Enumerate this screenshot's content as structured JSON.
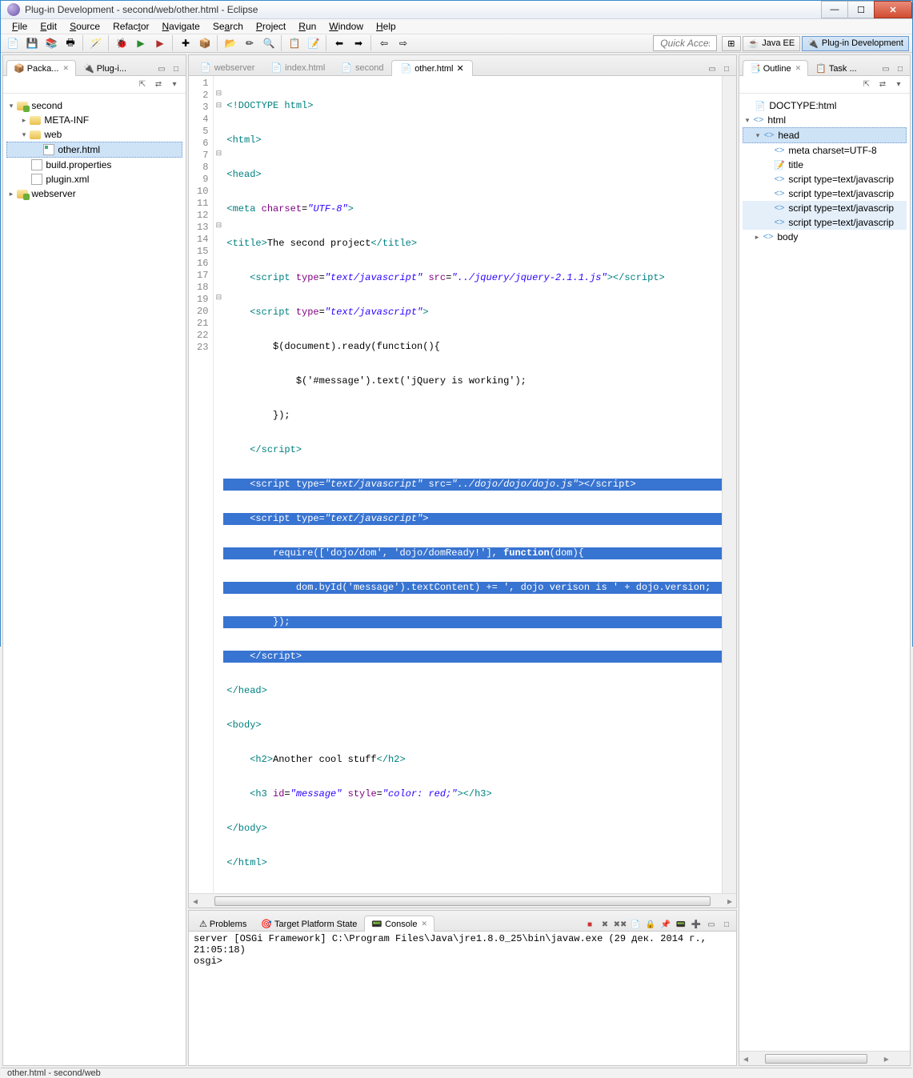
{
  "window": {
    "title": "Plug-in Development - second/web/other.html - Eclipse"
  },
  "menu": [
    "File",
    "Edit",
    "Source",
    "Refactor",
    "Navigate",
    "Search",
    "Project",
    "Run",
    "Window",
    "Help"
  ],
  "toolbar": {
    "quick_access": "Quick Access"
  },
  "perspectives": {
    "java_ee": "Java EE",
    "plugin_dev": "Plug-in Development"
  },
  "left_tabs": {
    "package": "Packa...",
    "plugins": "Plug-i..."
  },
  "project_tree": {
    "p_second": "second",
    "p_metainf": "META-INF",
    "p_web": "web",
    "p_other": "other.html",
    "p_build": "build.properties",
    "p_plugin": "plugin.xml",
    "p_webserver": "webserver"
  },
  "editor_tabs": {
    "webserver": "webserver",
    "index": "index.html",
    "second": "second",
    "other": "other.html"
  },
  "code": {
    "l1": "<!DOCTYPE html>",
    "l2": "<html>",
    "l3": "<head>",
    "l4_a": "<meta ",
    "l4_b": "charset",
    "l4_c": "=",
    "l4_d": "\"UTF-8\"",
    "l4_e": ">",
    "l5_a": "<title>",
    "l5_b": "The second project",
    "l5_c": "</title>",
    "l6_a": "    <script ",
    "l6_b": "type",
    "l6_c": "=",
    "l6_d": "\"text/javascript\"",
    "l6_e": " src",
    "l6_f": "=",
    "l6_g": "\"../jquery/jquery-2.1.1.js\"",
    "l6_h": "></script>",
    "l7_a": "    <script ",
    "l7_b": "type",
    "l7_c": "=",
    "l7_d": "\"text/javascript\"",
    "l7_e": ">",
    "l8": "        $(document).ready(function(){",
    "l9": "            $('#message').text('jQuery is working');",
    "l10": "        });",
    "l11": "    </script>",
    "l12_a": "    <script ",
    "l12_b": "type",
    "l12_c": "=",
    "l12_d": "\"text/javascript\"",
    "l12_e": " src",
    "l12_f": "=",
    "l12_g": "\"../dojo/dojo/dojo.js\"",
    "l12_h": "></script>",
    "l13_a": "    <script ",
    "l13_b": "type",
    "l13_c": "=",
    "l13_d": "\"text/javascript\"",
    "l13_e": ">",
    "l14_a": "        require(['dojo/dom', 'dojo/domReady!'], ",
    "l14_b": "function",
    "l14_c": "(dom){",
    "l15": "            dom.byId('message').textContent) += ', dojo verison is ' + dojo.version;",
    "l16": "        });",
    "l17": "    </script>",
    "l18": "</head>",
    "l19": "<body>",
    "l20_a": "    <h2>",
    "l20_b": "Another cool stuff",
    "l20_c": "</h2>",
    "l21_a": "    <h3 ",
    "l21_b": "id",
    "l21_c": "=",
    "l21_d": "\"message\"",
    "l21_e": " style",
    "l21_f": "=",
    "l21_g": "\"color: red;\"",
    "l21_h": "></h3>",
    "l22": "</body>",
    "l23": "</html>"
  },
  "outline": {
    "tab_outline": "Outline",
    "tab_task": "Task ...",
    "n1": "DOCTYPE:html",
    "n2": "html",
    "n3": "head",
    "n4": "meta charset=UTF-8",
    "n5": "title",
    "n6": "script type=text/javascrip",
    "n7": "script type=text/javascrip",
    "n8": "script type=text/javascrip",
    "n9": "script type=text/javascrip",
    "n10": "body"
  },
  "bottom_tabs": {
    "problems": "Problems",
    "target": "Target Platform State",
    "console": "Console"
  },
  "console": {
    "line1": "server [OSGi Framework] C:\\Program Files\\Java\\jre1.8.0_25\\bin\\javaw.exe (29 дек. 2014 г., 21:05:18)",
    "line2": "osgi>"
  },
  "status": "other.html - second/web"
}
